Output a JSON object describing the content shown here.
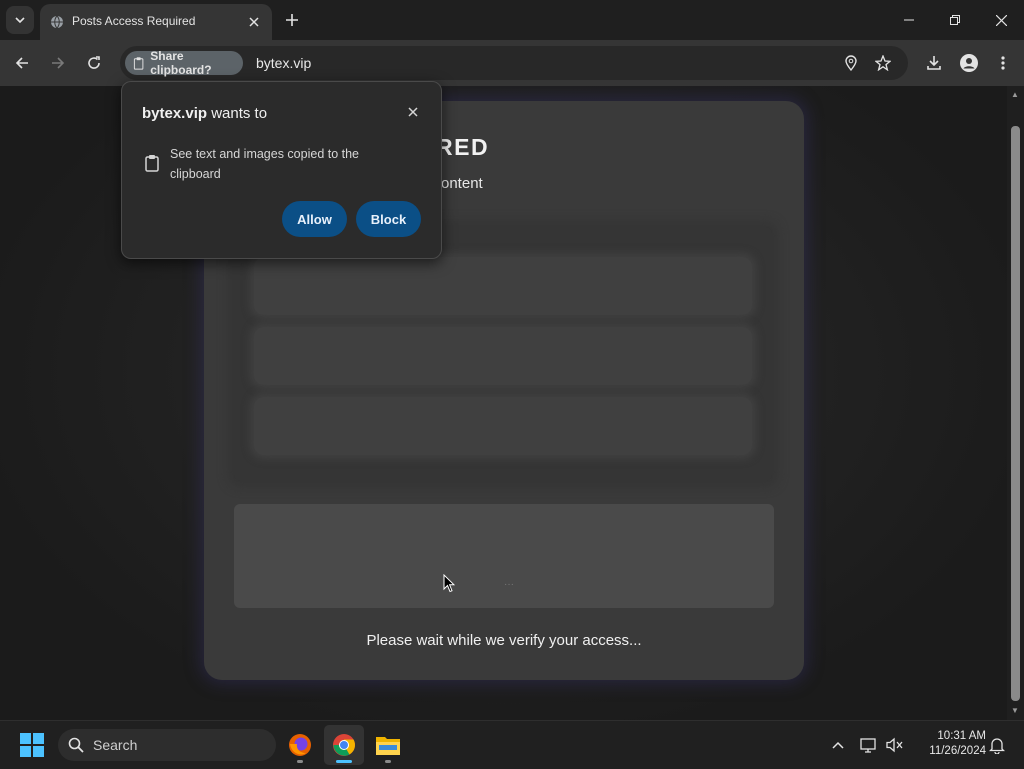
{
  "browser": {
    "tab_title": "Posts Access Required",
    "clipboard_chip_label": "Share clipboard?",
    "url": "bytex.vip"
  },
  "page": {
    "heading": "ACCESS REQUIRED",
    "subheading": "rmissions to view exclusive content",
    "status_text": "Please wait while we verify your access...",
    "verify_dots": "···"
  },
  "permission_popup": {
    "site": "bytex.vip",
    "wants_to": " wants to",
    "description": "See text and images copied to the clipboard",
    "allow_label": "Allow",
    "block_label": "Block"
  },
  "taskbar": {
    "search_placeholder": "Search",
    "time": "10:31 AM",
    "date": "11/26/2024"
  },
  "colors": {
    "button_blue": "#0b4f86",
    "chip_bg": "#5c6368",
    "card_bg": "#3a3a3a",
    "active_app_indicator": "#4cc2ff"
  }
}
